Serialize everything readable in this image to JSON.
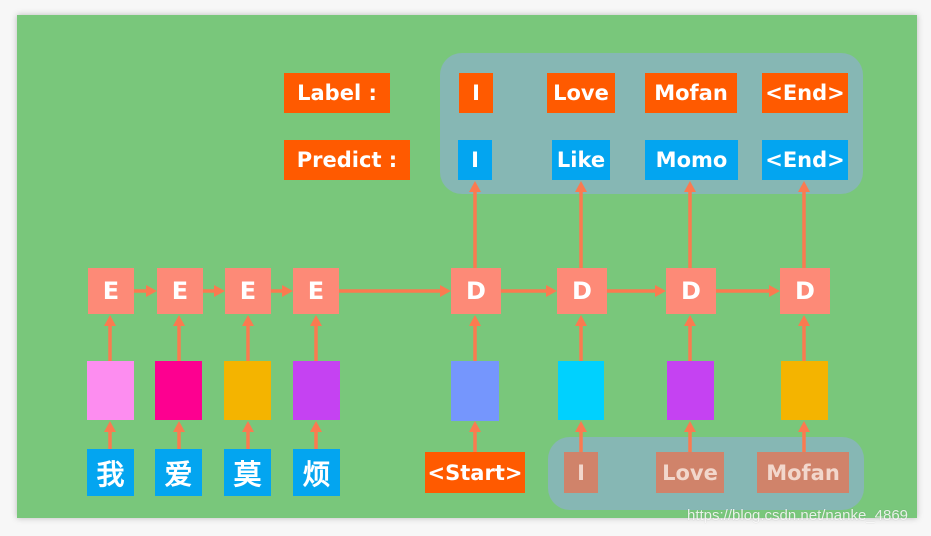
{
  "diagram": {
    "title_labels": {
      "label": "Label :",
      "predict": "Predict :"
    },
    "label_tokens": [
      "I",
      "Love",
      "Mofan",
      "<End>"
    ],
    "predict_tokens": [
      "I",
      "Like",
      "Momo",
      "<End>"
    ],
    "encoder": {
      "node_label": "E",
      "inputs": [
        "我",
        "爱",
        "莫",
        "烦"
      ],
      "embedding_colors": [
        "#fd8df0",
        "#fd0090",
        "#f4b400",
        "#c542f2"
      ]
    },
    "decoder": {
      "node_label": "D",
      "start_token": "<Start>",
      "teacher_inputs": [
        "I",
        "Love",
        "Mofan"
      ],
      "embedding_colors": [
        "#7596fd",
        "#00d1fe",
        "#c542f2",
        "#f4b400"
      ]
    },
    "colors": {
      "background": "#79c77b",
      "label_box": "#ff5a00",
      "predict_box": "#03a5f0",
      "node": "#fd8a77",
      "arrow": "#fb7a50",
      "group": "#86b7b4"
    }
  },
  "watermark": "https://blog.csdn.net/nanke_4869"
}
